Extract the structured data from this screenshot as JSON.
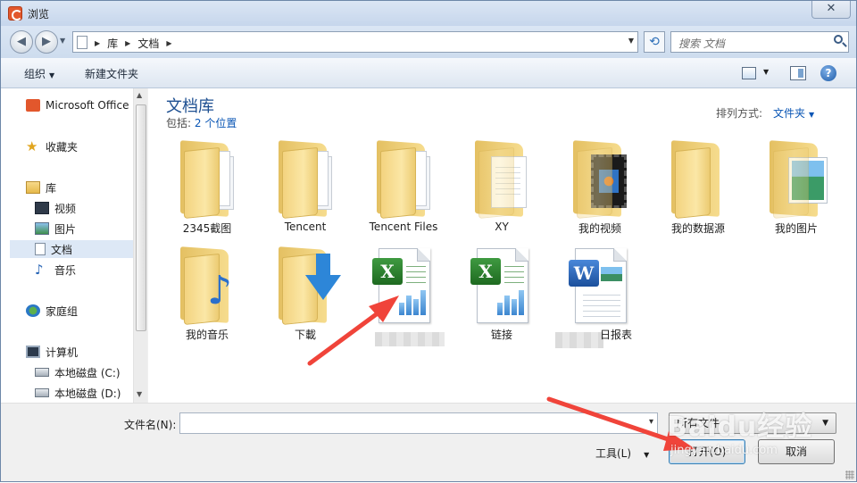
{
  "window": {
    "title": "浏览",
    "close": "✕"
  },
  "nav": {
    "back": "◀",
    "forward": "▶",
    "breadcrumbs": [
      "库",
      "文档"
    ],
    "search_placeholder": "搜索 文档",
    "refresh": "⟲"
  },
  "toolbar": {
    "organize": "组织",
    "new_folder": "新建文件夹",
    "help": "?"
  },
  "sidebar": {
    "items": [
      {
        "label": "Microsoft Office",
        "icon": "office-icon"
      },
      {
        "label": "收藏夹",
        "icon": "star-icon"
      },
      {
        "label": "库",
        "icon": "library-icon"
      },
      {
        "label": "视频",
        "icon": "video-icon"
      },
      {
        "label": "图片",
        "icon": "pictures-icon"
      },
      {
        "label": "文档",
        "icon": "documents-icon",
        "selected": true
      },
      {
        "label": "音乐",
        "icon": "music-icon"
      },
      {
        "label": "家庭组",
        "icon": "homegroup-icon"
      },
      {
        "label": "计算机",
        "icon": "computer-icon"
      },
      {
        "label": "本地磁盘 (C:)",
        "icon": "disk-icon"
      },
      {
        "label": "本地磁盘 (D:)",
        "icon": "disk-icon"
      }
    ]
  },
  "library": {
    "title": "文档库",
    "includes_prefix": "包括:",
    "includes_link": "2 个位置",
    "sort_label": "排列方式:",
    "sort_value": "文件夹"
  },
  "files": [
    {
      "name": "2345截图",
      "type": "folder"
    },
    {
      "name": "Tencent",
      "type": "folder"
    },
    {
      "name": "Tencent Files",
      "type": "folder"
    },
    {
      "name": "XY",
      "type": "folder"
    },
    {
      "name": "我的视频",
      "type": "folder-video"
    },
    {
      "name": "我的数据源",
      "type": "folder"
    },
    {
      "name": "我的图片",
      "type": "folder-picture"
    },
    {
      "name": "我的音乐",
      "type": "folder-music"
    },
    {
      "name": "下載",
      "type": "folder-download"
    },
    {
      "name": "",
      "type": "excel"
    },
    {
      "name": "链接",
      "type": "excel"
    },
    {
      "name": "日报表",
      "type": "word"
    }
  ],
  "bottom": {
    "filename_label": "文件名(N):",
    "filename_value": "",
    "filetype": "所有文件",
    "tools": "工具(L)",
    "open": "打开(O)",
    "cancel": "取消"
  },
  "watermark": {
    "main": "Baidu经验",
    "sub": "jingyan.baidu.com"
  },
  "colors": {
    "annotation_arrow": "#f0443a",
    "link": "#0a56b5",
    "title_blue": "#1d4f91"
  }
}
